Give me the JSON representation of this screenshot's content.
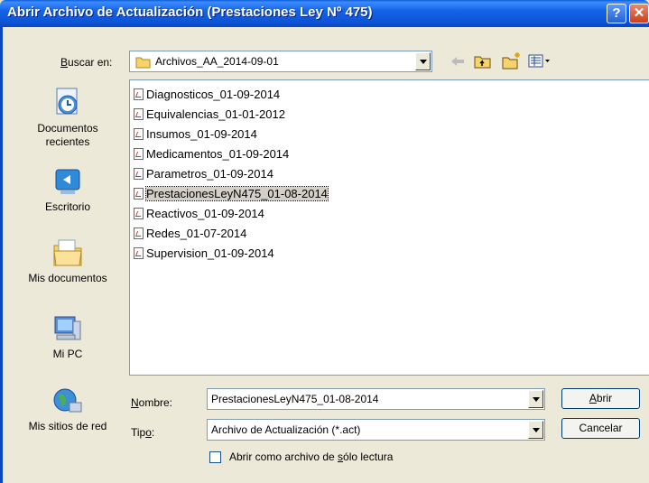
{
  "window": {
    "title": "Abrir Archivo de Actualización (Prestaciones Ley Nº 475)"
  },
  "lookin": {
    "label_u": "B",
    "label_rest": "uscar en:",
    "value": "Archivos_AA_2014-09-01"
  },
  "places": [
    {
      "label": "Documentos recientes",
      "icon": "recent-documents-icon"
    },
    {
      "label": "Escritorio",
      "icon": "desktop-icon"
    },
    {
      "label": "Mis documentos",
      "icon": "my-documents-icon"
    },
    {
      "label": "Mi PC",
      "icon": "my-computer-icon"
    },
    {
      "label": "Mis sitios de red",
      "icon": "network-places-icon"
    }
  ],
  "files": [
    "Diagnosticos_01-09-2014",
    "Equivalencias_01-01-2012",
    "Insumos_01-09-2014",
    "Medicamentos_01-09-2014",
    "Parametros_01-09-2014",
    "PrestacionesLeyN475_01-08-2014",
    "Reactivos_01-09-2014",
    "Redes_01-07-2014",
    "Supervision_01-09-2014"
  ],
  "selected_file": "PrestacionesLeyN475_01-08-2014",
  "filename": {
    "label_u": "N",
    "label_rest": "ombre:",
    "value": "PrestacionesLeyN475_01-08-2014"
  },
  "filetype": {
    "label_pre": "Tip",
    "label_u": "o",
    "label_post": ":",
    "value": "Archivo de Actualización (*.act)"
  },
  "readonly": {
    "label_pre": "Abrir como archivo de ",
    "label_u": "s",
    "label_post": "ólo lectura",
    "checked": false
  },
  "buttons": {
    "open_u": "A",
    "open_rest": "brir",
    "cancel": "Cancelar"
  }
}
